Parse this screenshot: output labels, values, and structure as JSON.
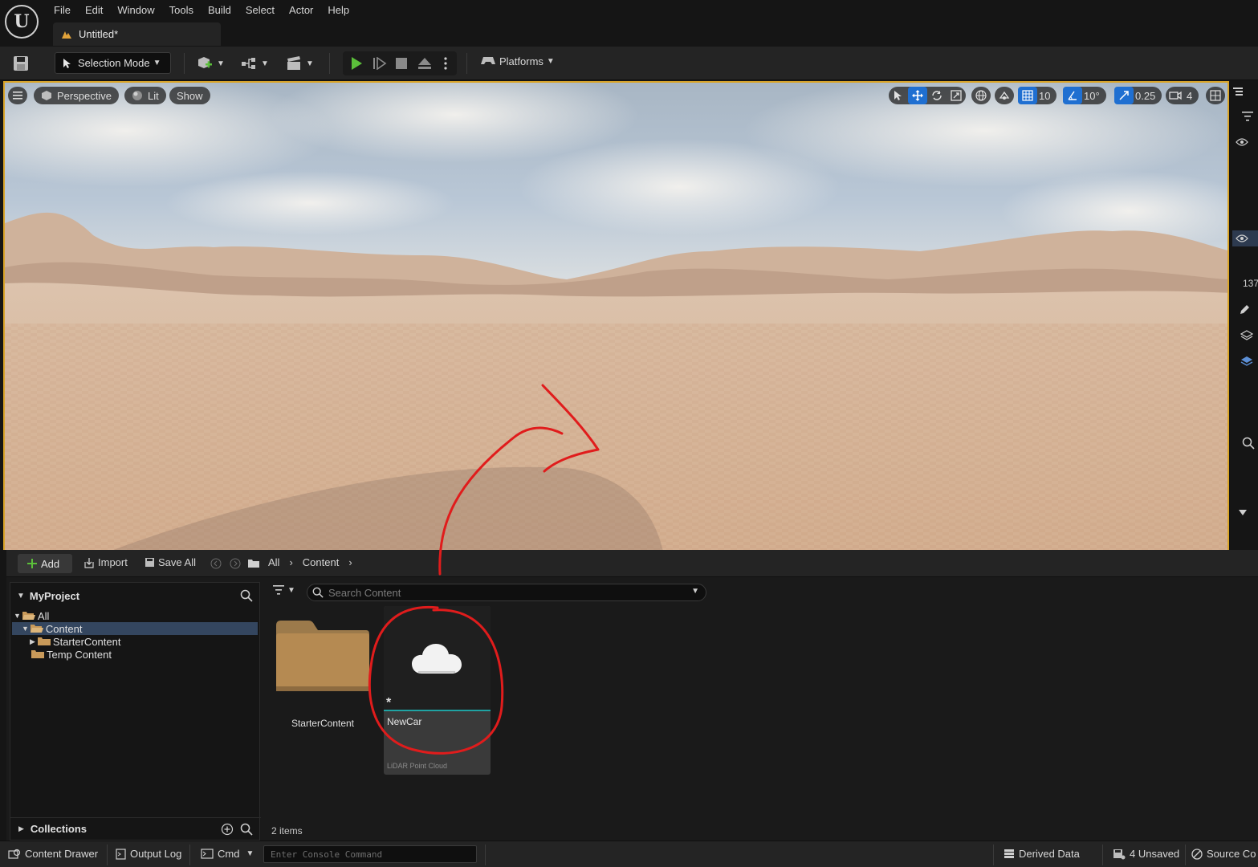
{
  "menu": {
    "items": [
      "File",
      "Edit",
      "Window",
      "Tools",
      "Build",
      "Select",
      "Actor",
      "Help"
    ]
  },
  "level_tab": {
    "label": "Untitled*"
  },
  "toolbar": {
    "selection_mode": "Selection Mode",
    "platforms": "Platforms"
  },
  "viewport": {
    "menu_label": "",
    "perspective": "Perspective",
    "lit": "Lit",
    "show": "Show",
    "grid_snap": "10",
    "rotation_snap": "10°",
    "scale_snap": "0.25",
    "camera_speed": "4"
  },
  "right_strip": {
    "value": "137"
  },
  "content_browser": {
    "add": "Add",
    "import": "Import",
    "save_all": "Save All",
    "breadcrumb": [
      "All",
      "Content"
    ],
    "search_placeholder": "Search Content",
    "project": "MyProject",
    "tree": [
      {
        "label": "All",
        "level": 0,
        "expanded": true,
        "selected": false
      },
      {
        "label": "Content",
        "level": 1,
        "expanded": true,
        "selected": true
      },
      {
        "label": "StarterContent",
        "level": 2,
        "expanded": false,
        "selected": false
      },
      {
        "label": "Temp Content",
        "level": 1,
        "expanded": false,
        "selected": false
      }
    ],
    "collections": "Collections",
    "assets": [
      {
        "name": "StarterContent",
        "kind": "folder"
      },
      {
        "name": "NewCar",
        "kind": "asset",
        "type": "LiDAR Point Cloud",
        "unsaved_marker": "*"
      }
    ],
    "item_count": "2 items"
  },
  "statusbar": {
    "content_drawer": "Content Drawer",
    "output_log": "Output Log",
    "cmd": "Cmd",
    "console_placeholder": "Enter Console Command",
    "derived_data": "Derived Data",
    "unsaved": "4 Unsaved",
    "source_control": "Source Co"
  },
  "colors": {
    "accent_blue": "#1f6fd1",
    "play_green": "#5bbf3a",
    "selection_border": "#d9a428",
    "folder": "#b58a52",
    "annotation_red": "#e01c1c",
    "asset_teal": "#1fa3a3"
  }
}
